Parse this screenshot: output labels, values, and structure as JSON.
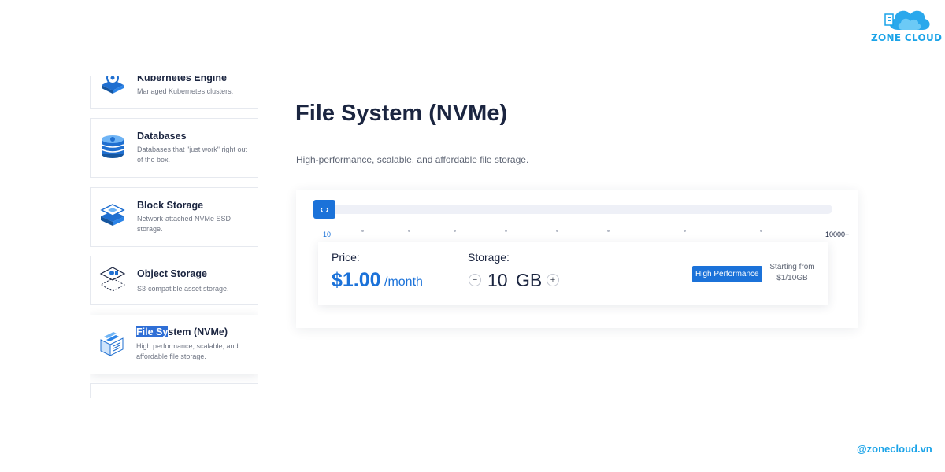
{
  "brand": {
    "logo_text": "ZONE CLOUD",
    "watermark": "@zonecloud.vn",
    "color": "#1aa3e8"
  },
  "accent_color": "#1b72d9",
  "products": [
    {
      "title": "Kubernetes Engine",
      "description": "Managed Kubernetes clusters.",
      "icon": "kubernetes-icon"
    },
    {
      "title": "Databases",
      "description": "Databases that \"just work\" right out of the box.",
      "icon": "database-icon"
    },
    {
      "title": "Block Storage",
      "description": "Network-attached NVMe SSD storage.",
      "icon": "block-storage-icon"
    },
    {
      "title": "Object Storage",
      "description": "S3-compatible asset storage.",
      "icon": "object-storage-icon"
    },
    {
      "title_selected": "File Sy",
      "title_rest": "stem (NVMe)",
      "description": "High performance, scalable, and affordable file storage.",
      "icon": "file-system-icon",
      "active": true
    }
  ],
  "main": {
    "title": "File System (NVMe)",
    "subtitle": "High-performance, scalable, and affordable file storage."
  },
  "slider": {
    "min_label": "10",
    "max_label": "10000+",
    "handle_icon": "chevron-left-right-icon",
    "value": 10
  },
  "pricing": {
    "price_label": "Price:",
    "price_value": "$1.00",
    "price_unit": "/month",
    "storage_label": "Storage:",
    "storage_value": "10",
    "storage_unit": "GB",
    "decrement": "−",
    "increment": "+",
    "badge": "High Performance",
    "starting_label": "Starting from",
    "starting_value": "$1/10GB"
  }
}
